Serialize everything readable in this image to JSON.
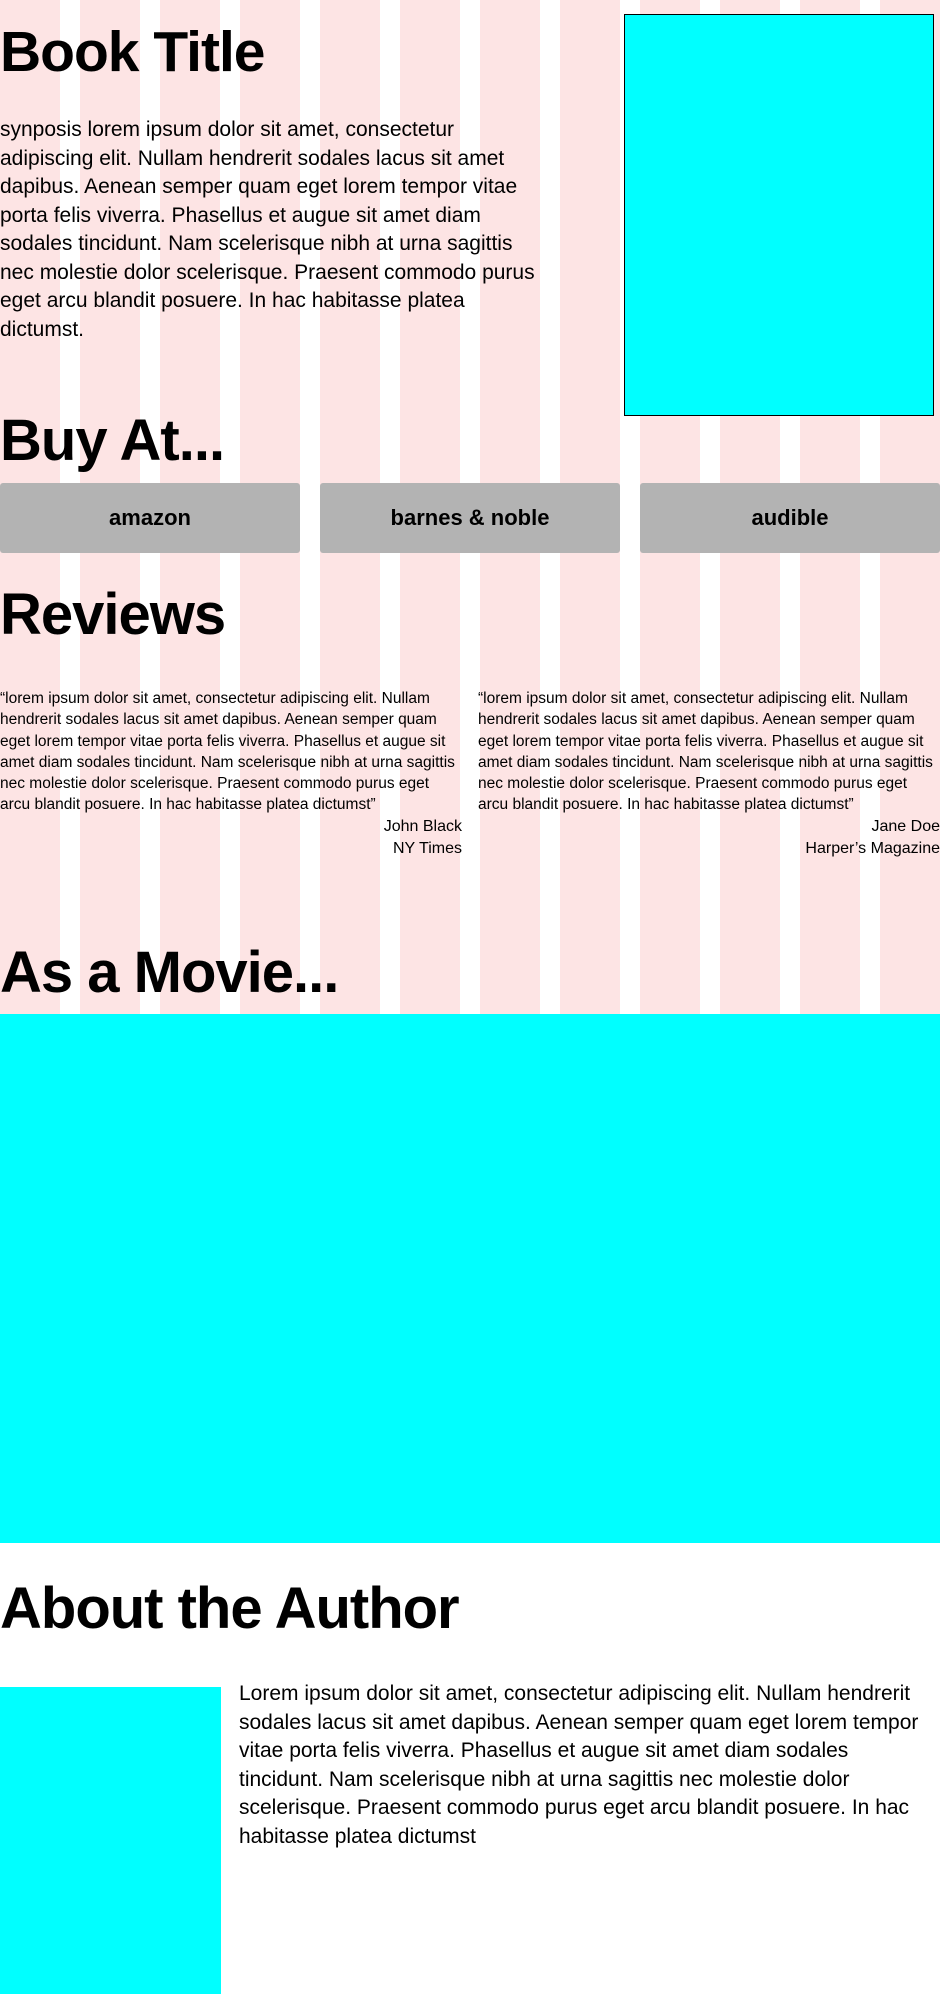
{
  "colors": {
    "grid_column": "#fde4e4",
    "placeholder": "#00ffff",
    "button": "#b3b3b3"
  },
  "book": {
    "title": "Book Title",
    "synopsis": "synposis lorem ipsum dolor sit amet, consectetur adipiscing elit. Nullam hendrerit sodales lacus sit amet dapibus. Aenean semper quam eget lorem tempor vitae porta felis viverra. Phasellus et augue sit amet diam sodales tincidunt. Nam scelerisque nibh at urna sagittis nec molestie dolor scelerisque. Praesent commodo purus eget arcu blandit posuere. In hac habitasse platea dictumst."
  },
  "buy": {
    "heading": "Buy At...",
    "buttons": [
      {
        "label": "amazon"
      },
      {
        "label": "barnes & noble"
      },
      {
        "label": "audible"
      }
    ]
  },
  "reviews": {
    "heading": "Reviews",
    "items": [
      {
        "quote": "“lorem ipsum dolor sit amet, consectetur adipiscing elit. Nullam hendrerit sodales lacus sit amet dapibus. Aenean semper quam eget lorem tempor vitae porta felis viverra. Phasellus et augue sit amet diam sodales tincidunt. Nam scelerisque nibh at urna sagittis nec molestie dolor scelerisque. Praesent commodo purus eget arcu blandit posuere. In hac habitasse platea dictumst”",
        "name": "John Black",
        "outlet": "NY Times"
      },
      {
        "quote": "“lorem ipsum dolor sit amet, consectetur adipiscing elit. Nullam hendrerit sodales lacus sit amet dapibus. Aenean semper quam eget lorem tempor vitae porta felis viverra. Phasellus et augue sit amet diam sodales tincidunt. Nam scelerisque nibh at urna sagittis nec molestie dolor scelerisque. Praesent commodo purus eget arcu blandit posuere. In hac habitasse platea dictumst”",
        "name": "Jane Doe",
        "outlet": "Harper’s Magazine"
      }
    ]
  },
  "movie": {
    "heading": "As a Movie..."
  },
  "author": {
    "heading": "About the Author",
    "bio": "Lorem ipsum dolor sit amet, consectetur adipiscing elit. Nullam hendrerit sodales lacus sit amet dapibus. Aenean semper quam eget lorem tempor vitae porta felis viverra. Phasellus et augue sit amet diam sodales tincidunt. Nam scelerisque nibh at urna sagittis nec molestie dolor scelerisque. Praesent commodo purus eget arcu blandit posuere. In hac habitasse platea dictumst"
  }
}
